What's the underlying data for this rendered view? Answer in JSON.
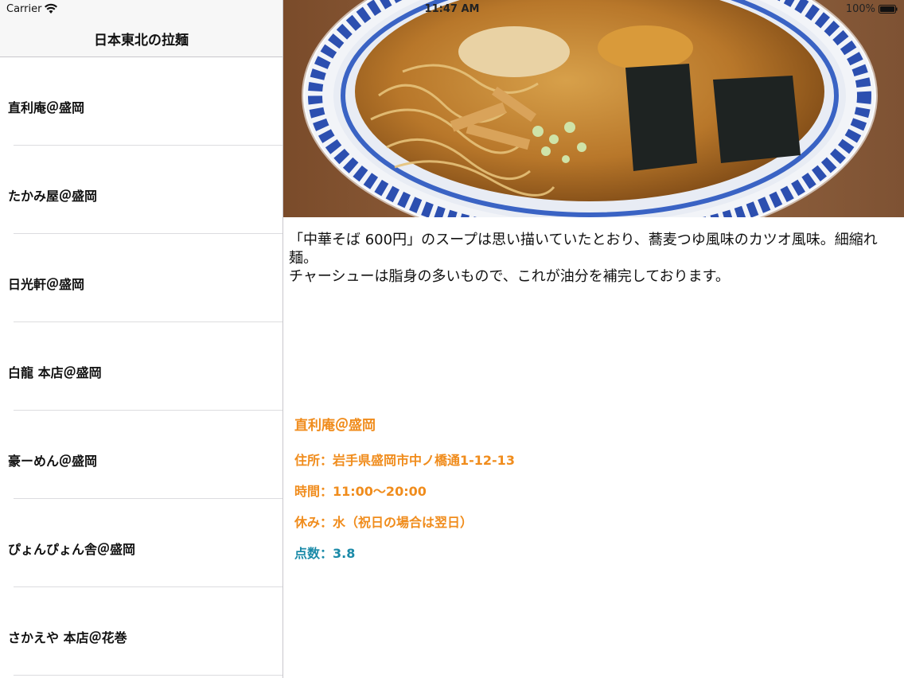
{
  "status_bar": {
    "carrier": "Carrier",
    "time": "11:47 AM",
    "battery": "100%"
  },
  "nav": {
    "title": "日本東北の拉麺"
  },
  "list": {
    "items": [
      {
        "label": "直利庵＠盛岡"
      },
      {
        "label": "たかみ屋＠盛岡"
      },
      {
        "label": "日光軒＠盛岡"
      },
      {
        "label": "白龍 本店＠盛岡"
      },
      {
        "label": "豪ーめん＠盛岡"
      },
      {
        "label": "ぴょんぴょん舎＠盛岡"
      },
      {
        "label": "さかえや 本店＠花巻"
      }
    ]
  },
  "detail": {
    "description_line1": "「中華そば 600円」のスープは思い描いていたとおり、蕎麦つゆ風味のカツオ風味。細縮れ麺。",
    "description_line2": "チャーシューは脂身の多いもので、これが油分を補完しております。",
    "name": "直利庵＠盛岡",
    "address": "住所：岩手県盛岡市中ノ橋通1-12-13",
    "hours": "時間：11:00〜20:00",
    "holiday": "休み：水（祝日の場合は翌日）",
    "score": "点数：3.8"
  },
  "colors": {
    "info_text": "#f08c1c",
    "score_text": "#1a8aa8",
    "nav_background": "#f7f7f7",
    "separator": "#dcdcdf"
  }
}
